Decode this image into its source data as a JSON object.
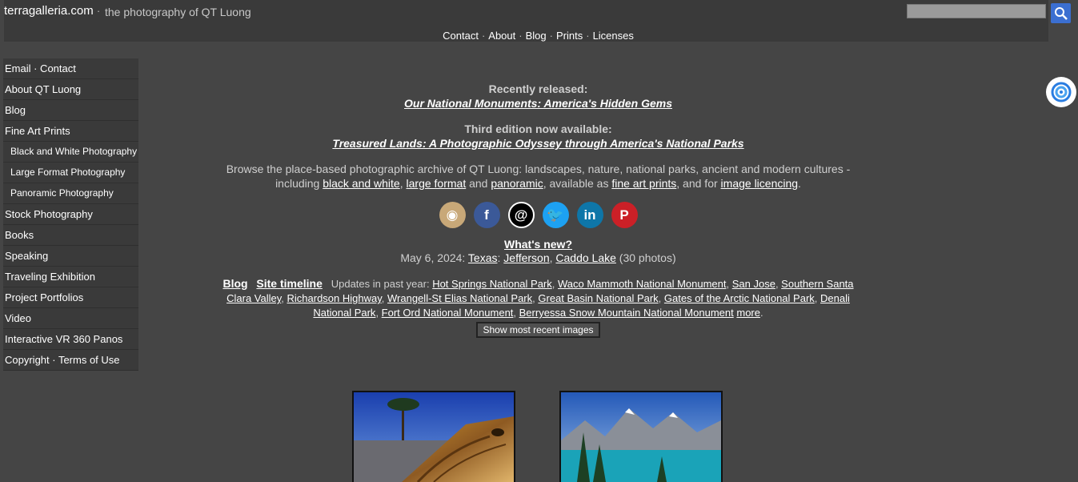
{
  "header": {
    "site_name": "terragalleria.com",
    "separator": "·",
    "tagline": "the photography of QT Luong",
    "nav": [
      "Contact",
      "About",
      "Blog",
      "Prints",
      "Licenses"
    ],
    "nav_sep": "·"
  },
  "sidebar": {
    "items": [
      {
        "label": "Email · Contact",
        "sub": false
      },
      {
        "label": "About QT Luong",
        "sub": false
      },
      {
        "label": "Blog",
        "sub": false
      },
      {
        "label": "Fine Art Prints",
        "sub": false
      },
      {
        "label": "Black and White Photography",
        "sub": true
      },
      {
        "label": "Large Format Photography",
        "sub": true
      },
      {
        "label": "Panoramic Photography",
        "sub": true
      },
      {
        "label": "Stock Photography",
        "sub": false
      },
      {
        "label": "Books",
        "sub": false
      },
      {
        "label": "Speaking",
        "sub": false
      },
      {
        "label": "Traveling Exhibition",
        "sub": false
      },
      {
        "label": "Project Portfolios",
        "sub": false
      },
      {
        "label": "Video",
        "sub": false
      },
      {
        "label": "Interactive VR 360 Panos",
        "sub": false
      },
      {
        "label": "Copyright · Terms of Use",
        "sub": false
      }
    ]
  },
  "main": {
    "recent_label": "Recently released:",
    "recent_book": "Our National Monuments: America's Hidden Gems",
    "edition_label": "Third edition now available:",
    "edition_book": "Treasured Lands: A Photographic Odyssey through America's National Parks",
    "desc_start": "Browse the place-based photographic archive of QT Luong: landscapes, nature, national parks, ancient and modern cultures - including ",
    "desc_link1": "black and white",
    "desc_comma1": ", ",
    "desc_link2": "large format",
    "desc_and": " and ",
    "desc_link3": "panoramic",
    "desc_mid": ", available as ",
    "desc_link4": "fine art prints",
    "desc_mid2": ", and for ",
    "desc_link5": "image licencing",
    "desc_end": ".",
    "whats_new": "What's new?",
    "update_date": "May 6, 2024: ",
    "update_loc1": "Texas",
    "update_colon": ": ",
    "update_loc2": "Jefferson",
    "update_comma": ", ",
    "update_loc3": "Caddo Lake",
    "update_count": " (30 photos)",
    "blog_link": "Blog",
    "timeline_link": "Site timeline",
    "updates_label": "Updates in past year: ",
    "updates": [
      "Hot Springs National Park",
      "Waco Mammoth National Monument",
      "San Jose",
      "Southern Santa Clara Valley",
      "Richardson Highway",
      "Wrangell-St Elias National Park",
      "Great Basin National Park",
      "Gates of the Arctic National Park",
      "Denali National Park",
      "Fort Ord National Monument",
      "Berryessa Snow Mountain National Monument"
    ],
    "more": "more",
    "recent_button": "Show most recent images"
  },
  "social": [
    {
      "name": "instagram-icon",
      "glyph": "◉",
      "color": "#c8a878"
    },
    {
      "name": "facebook-icon",
      "glyph": "f",
      "color": "#3b5998"
    },
    {
      "name": "threads-icon",
      "glyph": "@",
      "color": "#000000"
    },
    {
      "name": "twitter-icon",
      "glyph": "🐦",
      "color": "#1da1f2"
    },
    {
      "name": "linkedin-icon",
      "glyph": "in",
      "color": "#0e76a8"
    },
    {
      "name": "pinterest-icon",
      "glyph": "P",
      "color": "#cb2027"
    }
  ]
}
